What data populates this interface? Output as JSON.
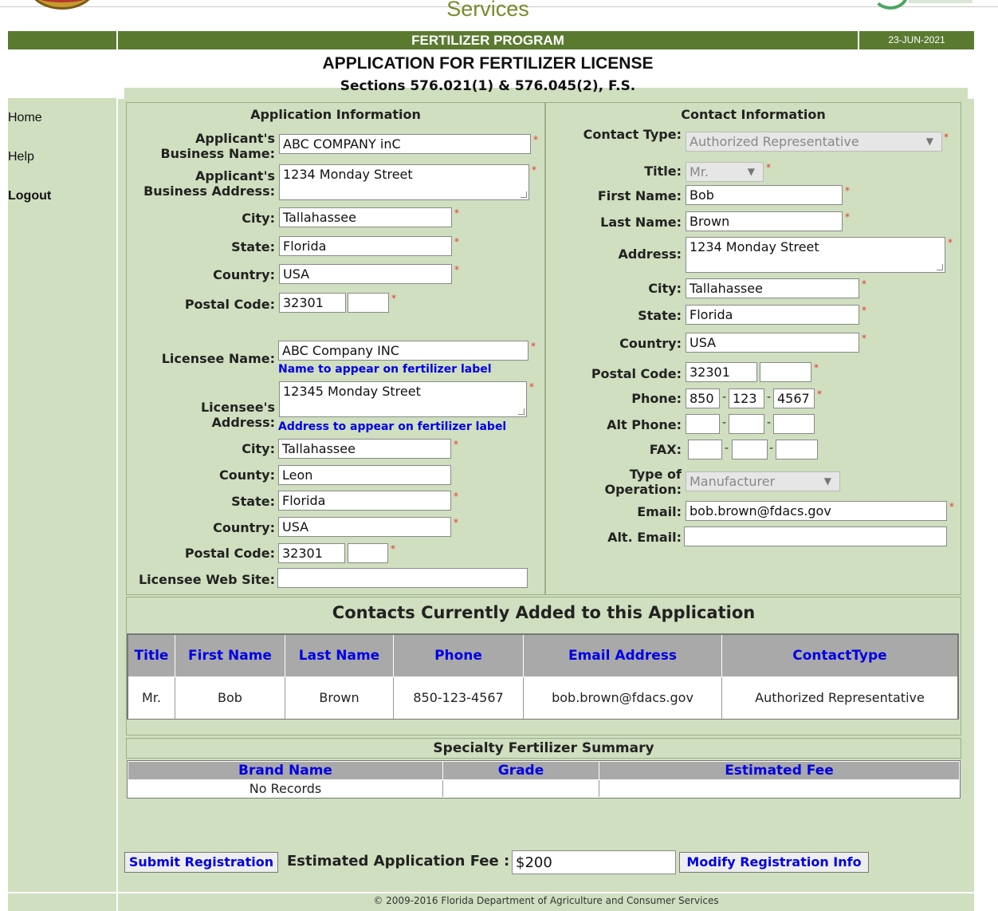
{
  "header": {
    "agency_word": "Services",
    "program": "FERTILIZER PROGRAM",
    "date": "23-JUN-2021",
    "title": "APPLICATION FOR FERTILIZER LICENSE",
    "subtitle": "Sections 576.021(1) & 576.045(2), F.S."
  },
  "nav": {
    "home": "Home",
    "help": "Help",
    "logout": "Logout"
  },
  "application": {
    "title": "Application Information",
    "business_name_label": "Applicant's Business Name:",
    "business_name": "ABC COMPANY inC",
    "business_address_label": "Applicant's Business Address:",
    "business_address": "1234 Monday Street",
    "city_label": "City:",
    "city": "Tallahassee",
    "state_label": "State:",
    "state": "Florida",
    "country_label": "Country:",
    "country": "USA",
    "postal_label": "Postal Code:",
    "postal": "32301",
    "postal_ext": "",
    "licensee_name_label": "Licensee Name:",
    "licensee_name": "ABC Company INC",
    "licensee_name_hint": "Name to appear on fertilizer label",
    "licensee_address_label": "Licensee's Address:",
    "licensee_address": "12345 Monday Street",
    "licensee_address_hint": "Address to appear on fertilizer label",
    "lic_city_label": "City:",
    "lic_city": "Tallahassee",
    "lic_county_label": "County:",
    "lic_county": "Leon",
    "lic_state_label": "State:",
    "lic_state": "Florida",
    "lic_country_label": "Country:",
    "lic_country": "USA",
    "lic_postal_label": "Postal Code:",
    "lic_postal": "32301",
    "lic_postal_ext": "",
    "web_label": "Licensee Web Site:",
    "web": ""
  },
  "contact": {
    "title": "Contact Information",
    "type_label": "Contact Type:",
    "type": "Authorized Representative",
    "title_label": "Title:",
    "title_value": "Mr.",
    "first_label": "First Name:",
    "first": "Bob",
    "last_label": "Last Name:",
    "last": "Brown",
    "address_label": "Address:",
    "address": "1234 Monday Street",
    "city_label": "City:",
    "city": "Tallahassee",
    "state_label": "State:",
    "state": "Florida",
    "country_label": "Country:",
    "country": "USA",
    "postal_label": "Postal Code:",
    "postal": "32301",
    "postal_ext": "",
    "phone_label": "Phone:",
    "phone": [
      "850",
      "123",
      "4567"
    ],
    "alt_phone_label": "Alt Phone:",
    "alt_phone": [
      "",
      "",
      ""
    ],
    "fax_label": "FAX:",
    "fax": [
      "",
      "",
      ""
    ],
    "op_label": "Type of Operation:",
    "op": "Manufacturer",
    "email_label": "Email:",
    "email": "bob.brown@fdacs.gov",
    "alt_email_label": "Alt. Email:",
    "alt_email": ""
  },
  "contacts_table": {
    "title": "Contacts Currently Added to this Application",
    "headers": [
      "Title",
      "First Name",
      "Last Name",
      "Phone",
      "Email Address",
      "ContactType"
    ],
    "rows": [
      [
        "Mr.",
        "Bob",
        "Brown",
        "850-123-4567",
        "bob.brown@fdacs.gov",
        "Authorized Representative"
      ]
    ]
  },
  "specialty": {
    "title": "Specialty Fertilizer Summary",
    "headers": [
      "Brand Name",
      "Grade",
      "Estimated Fee"
    ],
    "empty": "No Records"
  },
  "actions": {
    "submit": "Submit Registration",
    "fee_label": "Estimated Application Fee :",
    "fee": "$200",
    "modify": "Modify Registration Info"
  },
  "footer": "© 2009-2016 Florida Department of Agriculture and Consumer Services",
  "colors": {
    "banner": "#5a7a30",
    "panel_bg": "#cfdfbf",
    "link_blue": "#0000e6",
    "required": "#ee3333"
  }
}
